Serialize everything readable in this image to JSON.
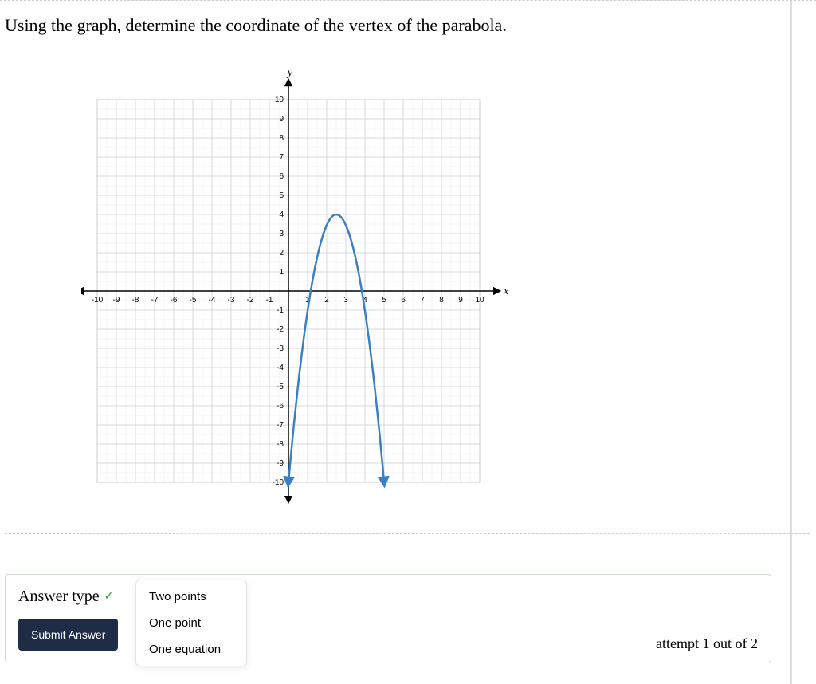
{
  "question": "Using the graph, determine the coordinate of the vertex of the parabola.",
  "answer_section": {
    "label": "Answer type",
    "submit": "Submit Answer",
    "attempt": "attempt 1 out of 2",
    "options": [
      "Two points",
      "One point",
      "One equation"
    ]
  },
  "chart_data": {
    "type": "line",
    "title": "",
    "xlabel": "x",
    "ylabel": "y",
    "xlim": [
      -10,
      10
    ],
    "ylim": [
      -10,
      10
    ],
    "x_ticks": [
      -10,
      -9,
      -8,
      -7,
      -6,
      -5,
      -4,
      -3,
      -2,
      -1,
      1,
      2,
      3,
      4,
      5,
      6,
      7,
      8,
      9,
      10
    ],
    "y_ticks": [
      -10,
      -9,
      -8,
      -7,
      -6,
      -5,
      -4,
      -3,
      -2,
      -1,
      1,
      2,
      3,
      4,
      5,
      6,
      7,
      8,
      9,
      10
    ],
    "grid": true,
    "series": [
      {
        "name": "parabola",
        "note": "Downward parabola, vertex (2.5, 4); passes through (0,-10), (1,-0.5), (2,3.5), (3,3.5), (4,-0.5), (5,-10)",
        "x": [
          0,
          0.5,
          1,
          1.5,
          2,
          2.5,
          3,
          3.5,
          4,
          4.5,
          5
        ],
        "y": [
          -10,
          -5.25,
          -0.5,
          2.5,
          3.5,
          4,
          3.5,
          2.5,
          -0.5,
          -5.25,
          -10
        ]
      }
    ]
  }
}
